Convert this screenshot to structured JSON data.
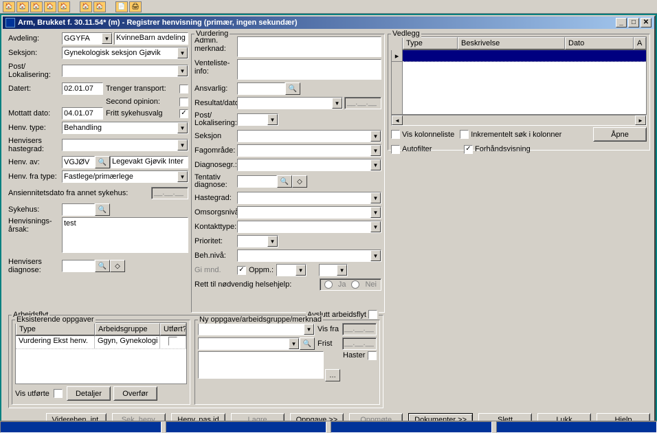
{
  "titlebar": "Arm, Brukket f. 30.11.54* (m) - Registrer henvisning (primær, ingen sekundær)",
  "left": {
    "avdeling_label": "Avdeling:",
    "avdeling_value": "GGYFA",
    "avdeling_text": "KvinneBarn avdeling",
    "seksjon_label": "Seksjon:",
    "seksjon_value": "Gynekologisk seksjon Gjøvik",
    "post_label": "Post/\nLokalisering:",
    "datert_label": "Datert:",
    "datert_value": "02.01.07",
    "mottatt_label": "Mottatt dato:",
    "mottatt_value": "04.01.07",
    "trenger_transport": "Trenger transport:",
    "second_opinion": "Second opinion:",
    "fritt_valg": "Fritt sykehusvalg",
    "henv_type_label": "Henv. type:",
    "henv_type_value": "Behandling",
    "henv_hastegrad_label": "Henvisers hastegrad:",
    "henv_av_label": "Henv. av:",
    "henv_av_value": "VGJØV",
    "henv_av_text": "Legevakt Gjøvik Inter",
    "henv_fra_type_label": "Henv. fra type:",
    "henv_fra_type_value": "Fastlege/primærlege",
    "ansien_label": "Ansiennitetsdato fra annet sykehus:",
    "ansien_value": "__.__.__",
    "sykehus_label": "Sykehus:",
    "henv_arsak_label": "Henvisnings-\nårsak:",
    "henv_arsak_value": "test",
    "henv_diag_label": "Henvisers diagnose:"
  },
  "vurdering": {
    "legend": "Vurdering",
    "admin_merknad": "Admin. merknad:",
    "venteliste": "Venteliste-\ninfo:",
    "ansvarlig": "Ansvarlig:",
    "resultat": "Resultat/dato",
    "resultat_date": "__.__.__",
    "post_lok": "Post/\nLokalisering:",
    "seksjon": "Seksjon",
    "fagomrade": "Fagområde:",
    "diagnosegr": "Diagnosegr.:",
    "tentativ": "Tentativ diagnose:",
    "hastegrad": "Hastegrad:",
    "omsorgs": "Omsorgsnivå:",
    "kontakttype": "Kontakttype:",
    "prioritet": "Prioritet:",
    "behniva": "Beh.nivå:",
    "gimnd": "Gi mnd.",
    "oppm": "Oppm.:",
    "oppm_val": "",
    "rett_label": "Rett til nødvendig helsehjelp:",
    "ja": "Ja",
    "nei": "Nei"
  },
  "avslutt": "Avslutt arbeidsflyt",
  "arbeidsflyt": {
    "legend": "Arbeidsflyt",
    "eksisterende": "Eksisterende oppgaver",
    "col_type": "Type",
    "col_arbeidsgruppe": "Arbeidsgruppe",
    "col_utfort": "Utført?",
    "row_type": "Vurdering Ekst henv.",
    "row_gruppe": "Ggyn, Gynekologi",
    "vis_utforte": "Vis utførte",
    "detaljer": "Detaljer",
    "overfor": "Overfør",
    "ny_oppgave": "Ny oppgave/arbeidsgruppe/merknad",
    "vis_fra": "Vis fra",
    "vis_fra_val": "__.__.__",
    "frist": "Frist",
    "frist_val": "__.__.__",
    "haster": "Haster"
  },
  "vedlegg": {
    "legend": "Vedlegg",
    "col_type": "Type",
    "col_beskr": "Beskrivelse",
    "col_dato": "Dato",
    "col_a": "A",
    "vis_kolonneliste": "Vis kolonneliste",
    "inkrement": "Inkrementelt søk i kolonner",
    "autofilter": "Autofilter",
    "forhand": "Forhåndsvisning",
    "apne": "Åpne"
  },
  "buttons": {
    "viderehen": "Viderehen. int.",
    "sek_henv": "Sek. henv.",
    "henv_pas": "Henv. pas.jd",
    "lagre": "Lagre",
    "oppgave": "Oppgave >>",
    "oppmote": "Oppmøte",
    "dokumenter": "Dokumenter >>",
    "slett": "Slett",
    "lukk": "Lukk",
    "hjelp": "Hjelp"
  }
}
